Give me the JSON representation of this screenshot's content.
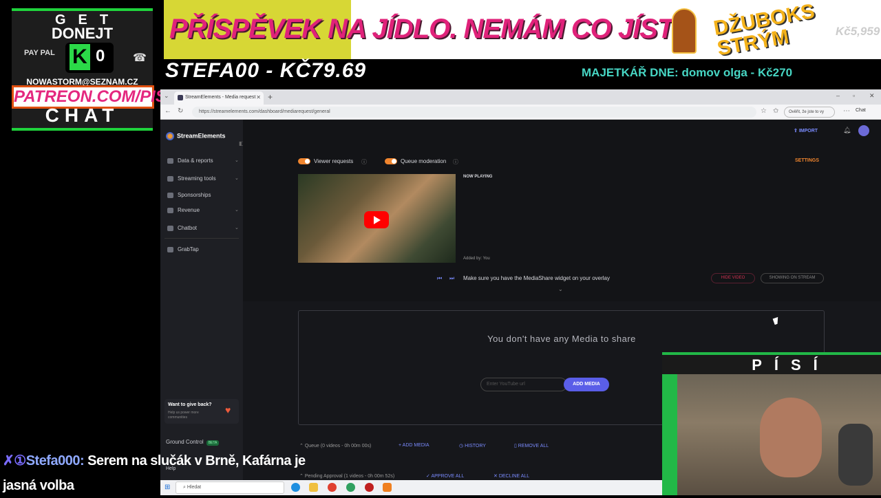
{
  "donate": {
    "title1": "GET",
    "title2": "DONEJT",
    "kcount": "0",
    "paypal": "PAY PAL",
    "email": "NOWASTORM@SEZNAM.CZ",
    "patreon": "PATREON.COM/PISI",
    "chat_label": "CHAT"
  },
  "banner": {
    "message": "PŘÍSPĚVEK NA JÍDLO. NEMÁM CO JÍST.",
    "jukebox_label": "DŽUBOKS STRÝM",
    "amount": "Kč5,959",
    "top_donor": "STEFA00 - KČ79.69",
    "majetkar": "MAJETKÁŘ DNE: domov olga  - Kč270"
  },
  "browser": {
    "tab_title": "StreamElements - Media request",
    "url": "https://streamelements.com/dashboard/mediarequest/general",
    "profile": "Ověřit, že jste to vy",
    "chat_btn": "Chat"
  },
  "sidebar": {
    "brand": "StreamElements",
    "items": [
      {
        "label": "Data & reports",
        "chev": true
      },
      {
        "label": "Streaming tools",
        "chev": true
      },
      {
        "label": "Sponsorships",
        "chev": false
      },
      {
        "label": "Revenue",
        "chev": true
      },
      {
        "label": "Chatbot",
        "chev": true
      },
      {
        "label": "GrabTap",
        "chev": false
      }
    ],
    "giveback_title": "Want to give back?",
    "giveback_sub": "Help us power more communities",
    "ground_control": "Ground Control",
    "beta": "BETA",
    "help": "Help"
  },
  "main": {
    "import": "IMPORT",
    "viewer_requests": "Viewer requests",
    "queue_moderation": "Queue moderation",
    "settings": "SETTINGS",
    "now_playing": "NOW PLAYING",
    "added_by": "Added by: You",
    "overlay_msg": "Make sure you have the MediaShare widget on your overlay",
    "hide_video": "HIDE VIDEO",
    "showing_on_stream": "SHOWING ON STREAM",
    "empty_msg": "You don't have any Media to share",
    "yt_placeholder": "Enter YouTube url",
    "add_media": "ADD MEDIA",
    "queue_label": "Queue (0 videos - 0h 00m 00s)",
    "queue_add_media": "ADD MEDIA",
    "history": "HISTORY",
    "remove_all": "REMOVE ALL",
    "pending_label": "Pending Approval (1 videos - 0h 00m 52s)",
    "approve_all": "APPROVE ALL",
    "decline_all": "DECLINE ALL"
  },
  "taskbar": {
    "search": "Hledat"
  },
  "cam": {
    "label": "PÍSÍ"
  },
  "chat": {
    "badges": "✗①",
    "user": "Stefa000:",
    "message": " Serem na slučák v Brně, Kafárna je jasná volba"
  },
  "colors": {
    "accent_green": "#1fd33c",
    "banner_pink": "#e0227a",
    "teal": "#47d6c4",
    "se_accent": "#7b8cff",
    "toggle_orange": "#f0852e"
  }
}
